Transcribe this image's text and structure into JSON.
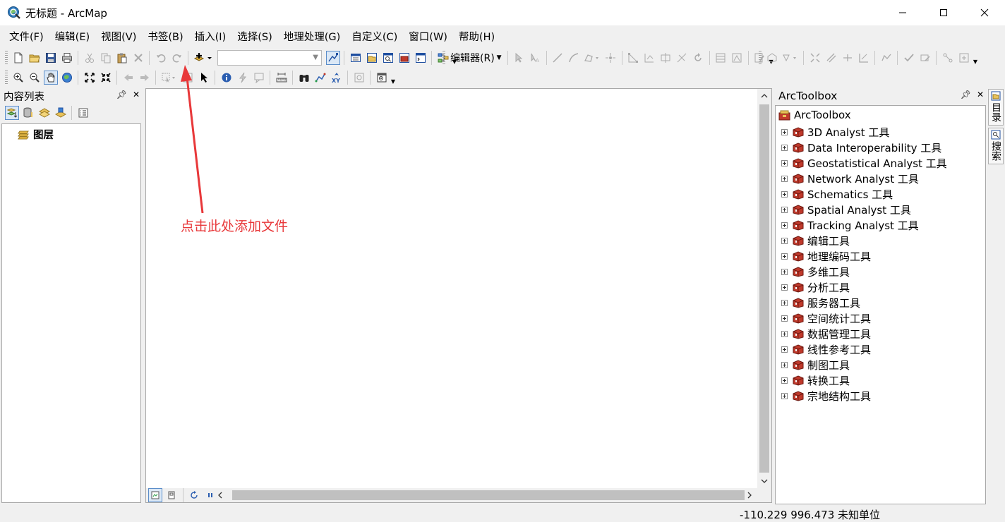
{
  "window": {
    "title": "无标题 - ArcMap",
    "minimize_glyph": "—",
    "maximize_glyph": "☐",
    "close_glyph": "✕"
  },
  "menu": [
    "文件(F)",
    "编辑(E)",
    "视图(V)",
    "书签(B)",
    "插入(I)",
    "选择(S)",
    "地理处理(G)",
    "自定义(C)",
    "窗口(W)",
    "帮助(H)"
  ],
  "toolbar": {
    "editor_label": "编辑器(R)",
    "scale_value": ""
  },
  "toc": {
    "title": "内容列表",
    "layers_label": "图层"
  },
  "annotation": {
    "text": "点击此处添加文件",
    "color": "#e8383a"
  },
  "arctoolbox": {
    "title": "ArcToolbox",
    "root": "ArcToolbox",
    "items": [
      "3D Analyst 工具",
      "Data Interoperability 工具",
      "Geostatistical Analyst 工具",
      "Network Analyst 工具",
      "Schematics 工具",
      "Spatial Analyst 工具",
      "Tracking Analyst 工具",
      "编辑工具",
      "地理编码工具",
      "多维工具",
      "分析工具",
      "服务器工具",
      "空间统计工具",
      "数据管理工具",
      "线性参考工具",
      "制图工具",
      "转换工具",
      "宗地结构工具"
    ]
  },
  "side_tabs": [
    "目录",
    "搜索"
  ],
  "status": {
    "coordinates": "-110.229  996.473 未知单位"
  }
}
